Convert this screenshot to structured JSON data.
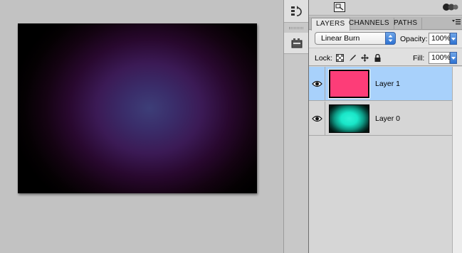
{
  "canvas": {
    "gradient_colors": [
      "#3d3e78",
      "#3b1a55",
      "#28082e",
      "#000000"
    ]
  },
  "dock": {
    "items": [
      {
        "icon": "history-icon"
      },
      {
        "icon": "actions-icon"
      }
    ]
  },
  "toolbar_icons": [
    "arrange-documents-icon",
    "panel-options-icon"
  ],
  "panel": {
    "tabs": [
      {
        "label": "LAYERS",
        "active": true
      },
      {
        "label": "CHANNELS",
        "active": false
      },
      {
        "label": "PATHS",
        "active": false
      }
    ],
    "blend_mode": "Linear Burn",
    "opacity_label": "Opacity:",
    "opacity_value": "100%",
    "lock_label": "Lock:",
    "lock_icons": [
      "lock-transparent-icon",
      "lock-image-icon",
      "lock-position-icon",
      "lock-all-icon"
    ],
    "fill_label": "Fill:",
    "fill_value": "100%",
    "layers": [
      {
        "name": "Layer 1",
        "selected": true,
        "visible": true,
        "thumb_color": "#fd3d78"
      },
      {
        "name": "Layer 0",
        "selected": false,
        "visible": true,
        "thumb_color": "#19e6c8"
      }
    ]
  },
  "colors": {
    "selection": "#a8d1fb",
    "accent_blue": "#2e72d2"
  }
}
